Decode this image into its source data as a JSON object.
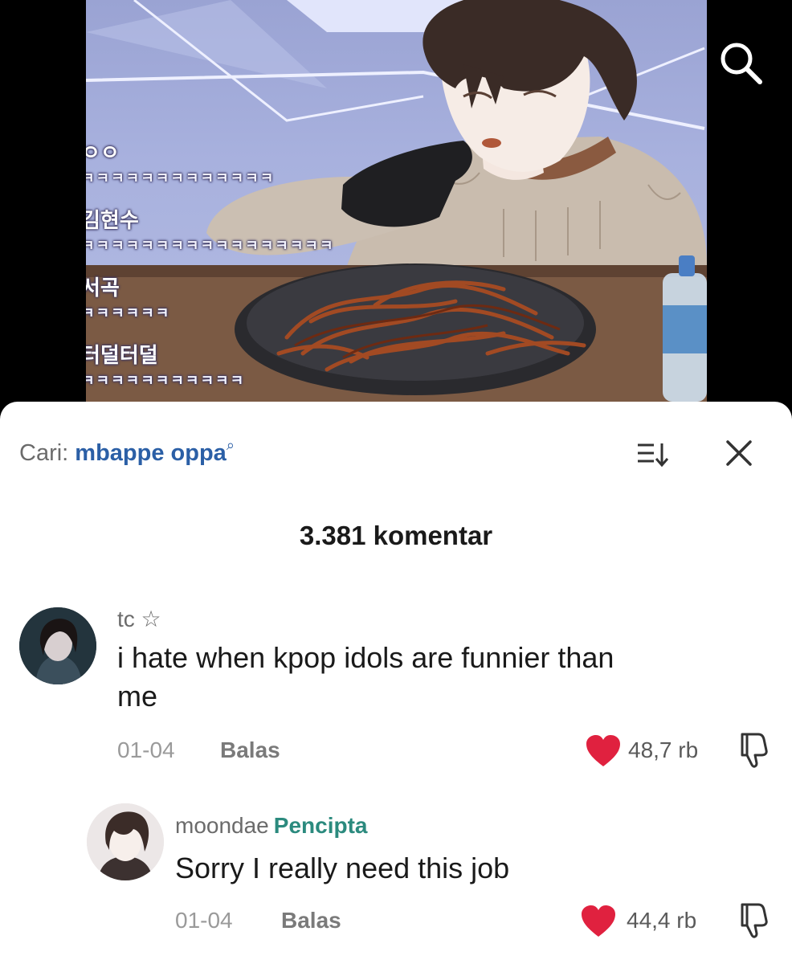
{
  "video": {
    "chat": [
      {
        "name": "ㅇㅇ",
        "message": "ㅋㅋㅋㅋㅋㅋㅋㅋㅋㅋㅋㅋㅋ"
      },
      {
        "name": "김현수",
        "message": "ㅋㅋㅋㅋㅋㅋㅋㅋㅋㅋㅋㅋㅋㅋㅋㅋㅋ"
      },
      {
        "name": "서곡",
        "message": "ㅋㅋㅋㅋㅋㅋ"
      },
      {
        "name": "터덜터덜",
        "message": "ㅋㅋㅋㅋㅋㅋㅋㅋㅋㅋㅋ"
      }
    ]
  },
  "sheet": {
    "search_label": "Cari:",
    "search_query": "mbappe oppa",
    "comment_count": "3.381 komentar"
  },
  "comments": [
    {
      "username": "tc ☆",
      "text_line1": "i hate when kpop idols are funnier than",
      "text_line2": "me",
      "date": "01-04",
      "reply_label": "Balas",
      "likes": "48,7 rb"
    },
    {
      "username": "moondae",
      "badge": "Pencipta",
      "text_line1": "Sorry I really need this job",
      "date": "01-04",
      "reply_label": "Balas",
      "likes": "44,4 rb"
    }
  ],
  "colors": {
    "heart": "#e0213f",
    "link": "#2b5fa6",
    "creator_badge": "#2b8a7e"
  }
}
